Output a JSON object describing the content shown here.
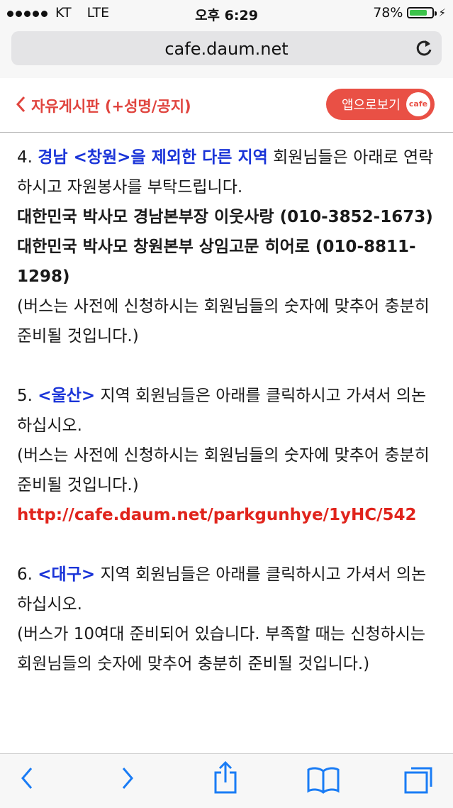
{
  "status_bar": {
    "carrier": "KT",
    "network": "LTE",
    "time": "오후 6:29",
    "battery_percent": "78%",
    "battery_level": 0.78,
    "colors": {
      "battery_fill": "#3cc34a"
    }
  },
  "address_bar": {
    "url": "cafe.daum.net",
    "reload_icon": "reload-icon"
  },
  "header": {
    "back_label": "자유게시판 (+성명/공지)",
    "app_button_label": "앱으로보기",
    "app_badge": "cafe",
    "colors": {
      "accent": "#e0443e",
      "app_button": "#e95045"
    }
  },
  "content": {
    "p4": {
      "num": "4. ",
      "region": "경남 <창원>을 제외한 다른 지역",
      "text": " 회원님들은 아래로 연락하시고 자원봉사를 부탁드립니다.",
      "contact1": "대한민국 박사모 경남본부장 이웃사랑 (010-3852-1673)",
      "contact2": "대한민국 박사모 창원본부 상임고문 히어로 (010-8811-1298)",
      "note": "(버스는 사전에 신청하시는 회원님들의 숫자에 맞추어 충분히 준비될 것입니다.)"
    },
    "p5": {
      "num": "5. ",
      "region": "<울산>",
      "text": " 지역 회원님들은 아래를 클릭하시고 가셔서 의논하십시오.",
      "note": "(버스는 사전에 신청하시는 회원님들의 숫자에 맞추어 충분히 준비될 것입니다.)",
      "link": "http://cafe.daum.net/parkgunhye/1yHC/542"
    },
    "p6": {
      "num": "6. ",
      "region": "<대구>",
      "text": " 지역 회원님들은 아래를 클릭하시고 가셔서 의논하십시오.",
      "note": "(버스가 10여대 준비되어 있습니다. 부족할 때는 신청하시는 회원님들의 숫자에 맞추어 충분히 준비될 것입니다.)"
    },
    "colors": {
      "region": "#1a34d8",
      "link": "#e0241c"
    }
  },
  "toolbar": {
    "icons": [
      "back-arrow-icon",
      "forward-arrow-icon",
      "share-icon",
      "bookmarks-icon",
      "tabs-icon"
    ],
    "colors": {
      "icon": "#1a7cf5"
    }
  }
}
